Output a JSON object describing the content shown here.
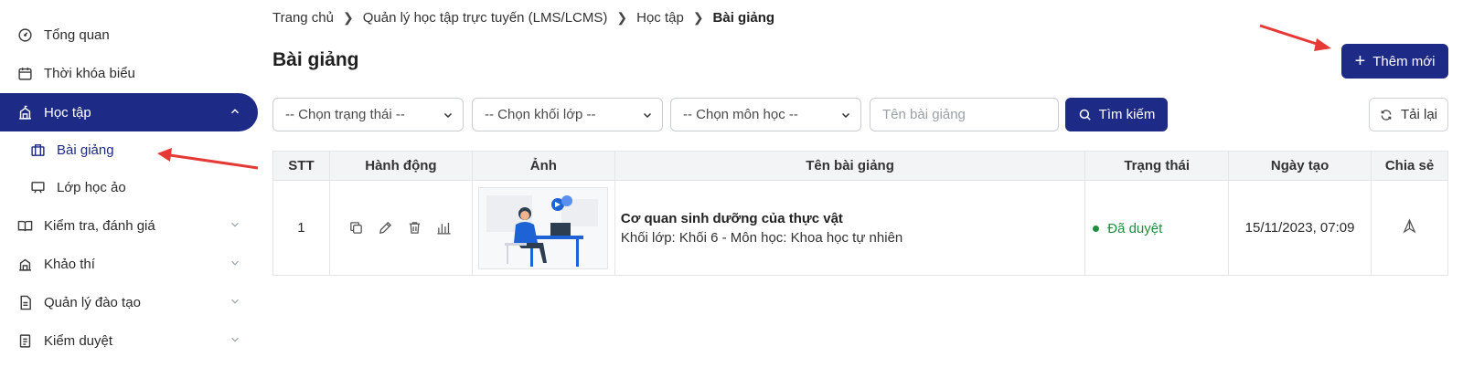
{
  "sidebar": {
    "items": [
      {
        "label": "Tổng quan",
        "icon": "dashboard-icon"
      },
      {
        "label": "Thời khóa biểu",
        "icon": "calendar-icon"
      },
      {
        "label": "Học tập",
        "icon": "school-icon",
        "active": true
      },
      {
        "label": "Kiểm tra, đánh giá",
        "icon": "book-icon"
      },
      {
        "label": "Khảo thí",
        "icon": "building-icon"
      },
      {
        "label": "Quản lý đào tạo",
        "icon": "document-icon"
      },
      {
        "label": "Kiểm duyệt",
        "icon": "checklist-icon"
      }
    ],
    "sub_items": [
      {
        "label": "Bài giảng",
        "icon": "lecture-icon",
        "selected": true
      },
      {
        "label": "Lớp học ảo",
        "icon": "screen-icon"
      }
    ]
  },
  "breadcrumb": {
    "items": [
      "Trang chủ",
      "Quản lý học tập trực tuyến (LMS/LCMS)",
      "Học tập"
    ],
    "current": "Bài giảng"
  },
  "page": {
    "title": "Bài giảng",
    "add_button": "Thêm mới",
    "reload_button": "Tải lại"
  },
  "filters": {
    "status_select": "-- Chọn trạng thái --",
    "grade_select": "-- Chọn khối lớp --",
    "subject_select": "-- Chọn môn học --",
    "name_placeholder": "Tên bài giảng",
    "search_button": "Tìm kiếm"
  },
  "table": {
    "headers": [
      "STT",
      "Hành động",
      "Ảnh",
      "Tên bài giảng",
      "Trạng thái",
      "Ngày tạo",
      "Chia sẻ"
    ],
    "rows": [
      {
        "stt": "1",
        "title": "Cơ quan sinh dưỡng của thực vật",
        "meta": "Khối lớp: Khối 6 - Môn học: Khoa học tự nhiên",
        "status": "Đã duyệt",
        "created": "15/11/2023, 07:09"
      }
    ]
  },
  "colors": {
    "primary": "#1d2a86",
    "status_approved": "#1e8e3e",
    "annotation_arrow": "#e53935"
  }
}
